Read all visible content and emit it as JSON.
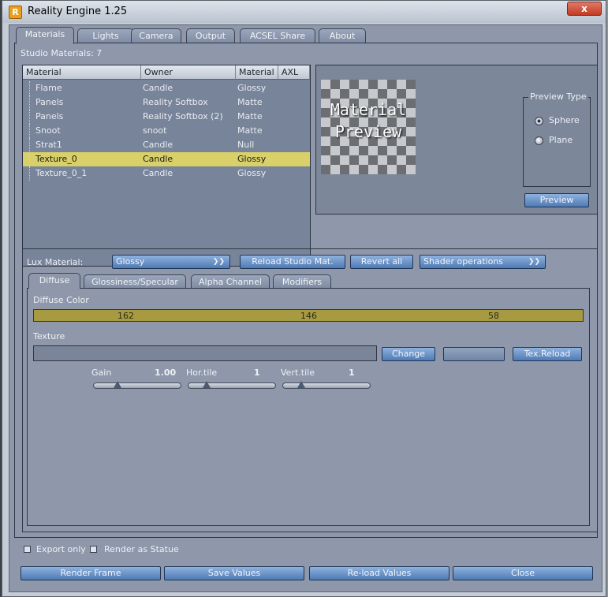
{
  "window": {
    "title": "Reality Engine 1.25",
    "close_glyph": "x"
  },
  "tabs": [
    "Materials",
    "Lights",
    "Camera",
    "Output",
    "ACSEL Share",
    "About"
  ],
  "studio_materials_label": "Studio Materials: 7",
  "table": {
    "columns": [
      "Material",
      "Owner",
      "Material",
      "AXL"
    ],
    "rows": [
      {
        "material": "Flame",
        "owner": "Candle",
        "type": "Glossy"
      },
      {
        "material": "Panels",
        "owner": "Reality Softbox",
        "type": "Matte"
      },
      {
        "material": "Panels",
        "owner": "Reality Softbox (2)",
        "type": "Matte"
      },
      {
        "material": "Snoot",
        "owner": "snoot",
        "type": "Matte"
      },
      {
        "material": "Strat1",
        "owner": "Candle",
        "type": "Null"
      },
      {
        "material": "Texture_0",
        "owner": "Candle",
        "type": "Glossy",
        "selected": true
      },
      {
        "material": "Texture_0_1",
        "owner": "Candle",
        "type": "Glossy"
      }
    ]
  },
  "preview": {
    "image_text_line1": "Material",
    "image_text_line2": "Preview",
    "type_group_label": "Preview Type",
    "options": [
      "Sphere",
      "Plane"
    ],
    "selected_option": "Sphere",
    "button_label": "Preview"
  },
  "lux": {
    "label": "Lux Material:",
    "value": "Glossy",
    "reload_label": "Reload Studio Mat.",
    "revert_label": "Revert all",
    "shader_ops_label": "Shader operations"
  },
  "subtabs": [
    "Diffuse",
    "Glossiness/Specular",
    "Alpha Channel",
    "Modifiers"
  ],
  "diffuse": {
    "color_label": "Diffuse Color",
    "rgb": [
      162,
      146,
      58
    ],
    "swatch_color": "#a89a40",
    "texture_label": "Texture",
    "texture_value": "",
    "change_label": "Change",
    "disabled_button_label": "",
    "tex_reload_label": "Tex.Reload"
  },
  "sliders": [
    {
      "label": "Gain",
      "value": "1.00",
      "level": 0.25
    },
    {
      "label": "Hor.tile",
      "value": "1",
      "level": 0.18
    },
    {
      "label": "Vert.tile",
      "value": "1",
      "level": 0.18
    }
  ],
  "footer": {
    "export_only_label": "Export only",
    "render_statue_label": "Render as Statue",
    "buttons": [
      "Render Frame",
      "Save Values",
      "Re-load Values",
      "Close"
    ]
  },
  "colors": {
    "selected_row": "#d9d06a",
    "button_blue": "#5a84bd",
    "panel": "#8e98aa"
  }
}
